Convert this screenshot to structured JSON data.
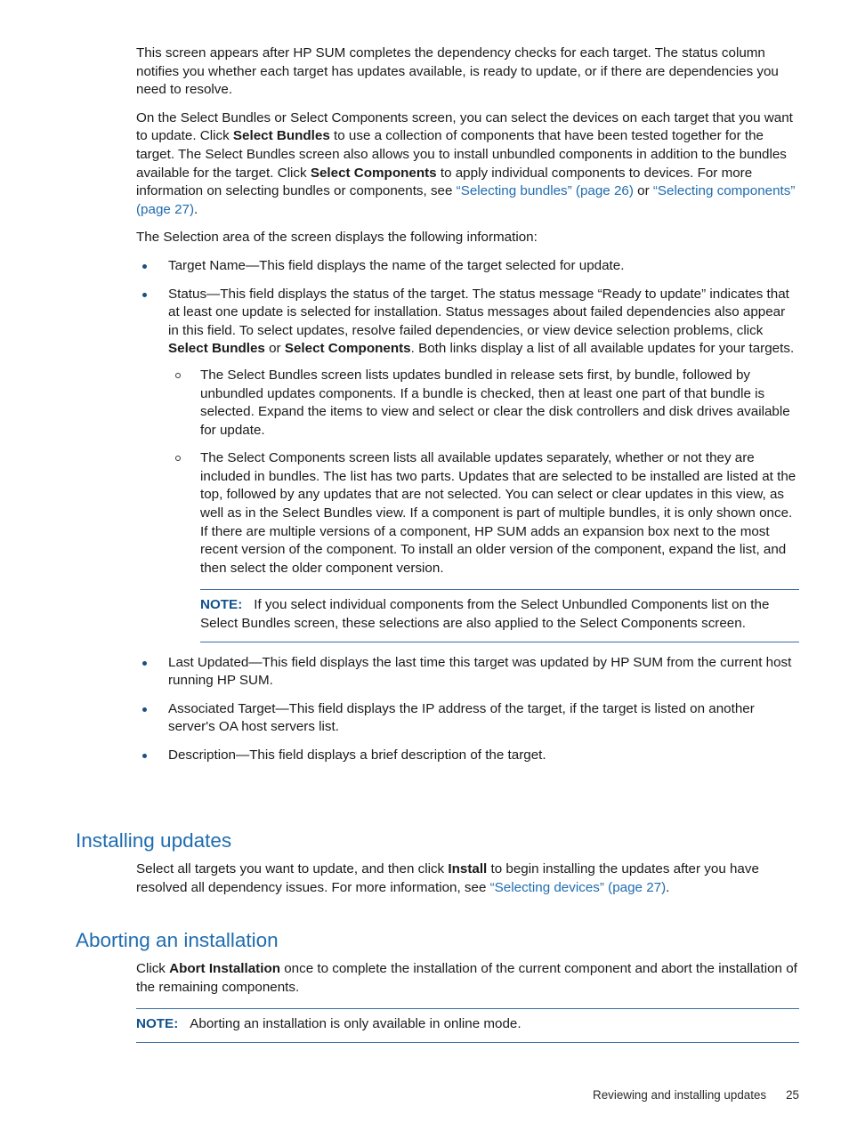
{
  "document": {
    "page_number": "25",
    "footer_title": "Reviewing and installing updates"
  },
  "intro": {
    "para1": "This screen appears after HP SUM completes the dependency checks for each target. The status column notifies you whether each target has updates available, is ready to update, or if there are dependencies you need to resolve.",
    "para2_part1": "On the Select Bundles or Select Components screen, you can select the devices on each target that you want to update. Click ",
    "para2_bold1": "Select Bundles",
    "para2_part2": " to use a collection of components that have been tested together for the target. The Select Bundles screen also allows you to install unbundled components in addition to the bundles available for the target. Click ",
    "para2_bold2": "Select Components",
    "para2_part3": " to apply individual components to devices. For more information on selecting bundles or components, see ",
    "para2_link1": "“Selecting bundles” (page 26)",
    "para2_part4": " or ",
    "para2_link2": "“Selecting components” (page 27)",
    "para2_part5": ".",
    "para3": "The Selection area of the screen displays the following information:"
  },
  "selection_fields": {
    "target_name": "Target Name—This field displays the name of the target selected for update.",
    "status_part1": "Status—This field displays the status of the target. The status message “Ready to update” indicates that at least one update is selected for installation. Status messages about failed dependencies also appear in this field. To select updates, resolve failed dependencies, or view device selection problems, click ",
    "status_bold1": "Select Bundles",
    "status_part2": " or ",
    "status_bold2": "Select Components",
    "status_part3": ". Both links display a list of all available updates for your targets.",
    "sub_bullet_bundles": "The Select Bundles screen lists updates bundled in release sets first, by bundle, followed by unbundled updates components. If a bundle is checked, then at least one part of that bundle is selected. Expand the items to view and select or clear the disk controllers and disk drives available for update.",
    "sub_bullet_components": "The Select Components screen lists all available updates separately, whether or not they are included in bundles. The list has two parts. Updates that are selected to be installed are listed at the top, followed by any updates that are not selected. You can select or clear updates in this view, as well as in the Select Bundles view. If a component is part of multiple bundles, it is only shown once. If there are multiple versions of a component, HP SUM adds an expansion box next to the most recent version of the component. To install an older version of the component, expand the list, and then select the older component version.",
    "note1_label": "NOTE:",
    "note1_text": "If you select individual components from the Select Unbundled Components list on the Select Bundles screen, these selections are also applied to the Select Components screen.",
    "last_updated": "Last Updated—This field displays the last time this target was updated by HP SUM from the current host running HP SUM.",
    "associated_target": "Associated Target—This field displays the IP address of the target, if the target is listed on another server's OA host servers list.",
    "description": "Description—This field displays a brief description of the target."
  },
  "installing_updates": {
    "heading": "Installing updates",
    "body_part1": "Select all targets you want to update, and then click ",
    "body_bold1": "Install",
    "body_part2": " to begin installing the updates after you have resolved all dependency issues. For more information, see ",
    "body_link1": "“Selecting devices” (page 27)",
    "body_part3": "."
  },
  "aborting_installation": {
    "heading": "Aborting an installation",
    "body_part1": "Click ",
    "body_bold1": "Abort Installation",
    "body_part2": " once to complete the installation of the current component and abort the installation of the remaining components.",
    "note_label": "NOTE:",
    "note_text": "Aborting an installation is only available in online mode."
  },
  "colors": {
    "heading_blue": "#1f6cb0",
    "link_blue": "#1f6cb0",
    "note_label_blue": "#10518f",
    "bullet_blue": "#1c4f82",
    "rule_blue": "#3a6ea5",
    "body_text": "#1a1a1a"
  }
}
